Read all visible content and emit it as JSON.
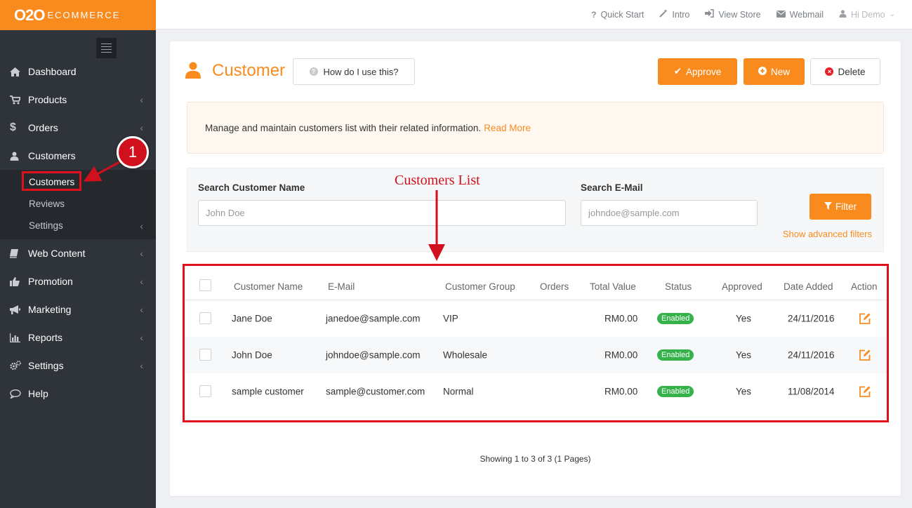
{
  "logo": {
    "primary": "O2O",
    "secondary": "ECOMMERCE"
  },
  "topbar": {
    "items": [
      {
        "label": "Quick Start",
        "icon": "question-icon"
      },
      {
        "label": "Intro",
        "icon": "magic-wand-icon"
      },
      {
        "label": "View Store",
        "icon": "sign-in-icon"
      },
      {
        "label": "Webmail",
        "icon": "envelope-icon"
      }
    ],
    "user": "Hi Demo"
  },
  "sidebar": {
    "items": [
      {
        "label": "Dashboard",
        "icon": "home-icon"
      },
      {
        "label": "Products",
        "icon": "cart-icon"
      },
      {
        "label": "Orders",
        "icon": "dollar-icon"
      },
      {
        "label": "Customers",
        "icon": "user-icon"
      },
      {
        "label": "Web Content",
        "icon": "book-icon"
      },
      {
        "label": "Promotion",
        "icon": "thumbs-up-icon"
      },
      {
        "label": "Marketing",
        "icon": "bullhorn-icon"
      },
      {
        "label": "Reports",
        "icon": "bar-chart-icon"
      },
      {
        "label": "Settings",
        "icon": "gears-icon"
      },
      {
        "label": "Help",
        "icon": "comment-icon"
      }
    ],
    "customers_sub": [
      "Customers",
      "Reviews",
      "Settings"
    ]
  },
  "page": {
    "title": "Customer",
    "howto": "How do I use this?",
    "approve": "Approve",
    "new": "New",
    "delete": "Delete",
    "info_text": "Manage and maintain customers list with their related information.",
    "read_more": "Read More"
  },
  "filters": {
    "name_label": "Search Customer Name",
    "name_placeholder": "John Doe",
    "email_label": "Search E-Mail",
    "email_placeholder": "johndoe@sample.com",
    "filter_button": "Filter",
    "advanced": "Show advanced filters"
  },
  "table": {
    "headers": [
      "Customer Name",
      "E-Mail",
      "Customer Group",
      "Orders",
      "Total Value",
      "Status",
      "Approved",
      "Date Added",
      "Action"
    ],
    "rows": [
      {
        "name": "Jane Doe",
        "email": "janedoe@sample.com",
        "group": "VIP",
        "orders": "",
        "total": "RM0.00",
        "status": "Enabled",
        "approved": "Yes",
        "date": "24/11/2016"
      },
      {
        "name": "John Doe",
        "email": "johndoe@sample.com",
        "group": "Wholesale",
        "orders": "",
        "total": "RM0.00",
        "status": "Enabled",
        "approved": "Yes",
        "date": "24/11/2016"
      },
      {
        "name": "sample customer",
        "email": "sample@customer.com",
        "group": "Normal",
        "orders": "",
        "total": "RM0.00",
        "status": "Enabled",
        "approved": "Yes",
        "date": "11/08/2014"
      }
    ]
  },
  "pagination": "Showing 1 to 3 of 3 (1 Pages)",
  "annotations": {
    "step_number": "1",
    "list_label": "Customers List"
  },
  "colors": {
    "accent": "#f98b1e",
    "sidebar": "#2f343a",
    "annotation": "#e0101c",
    "status_enabled": "#35b34a"
  }
}
